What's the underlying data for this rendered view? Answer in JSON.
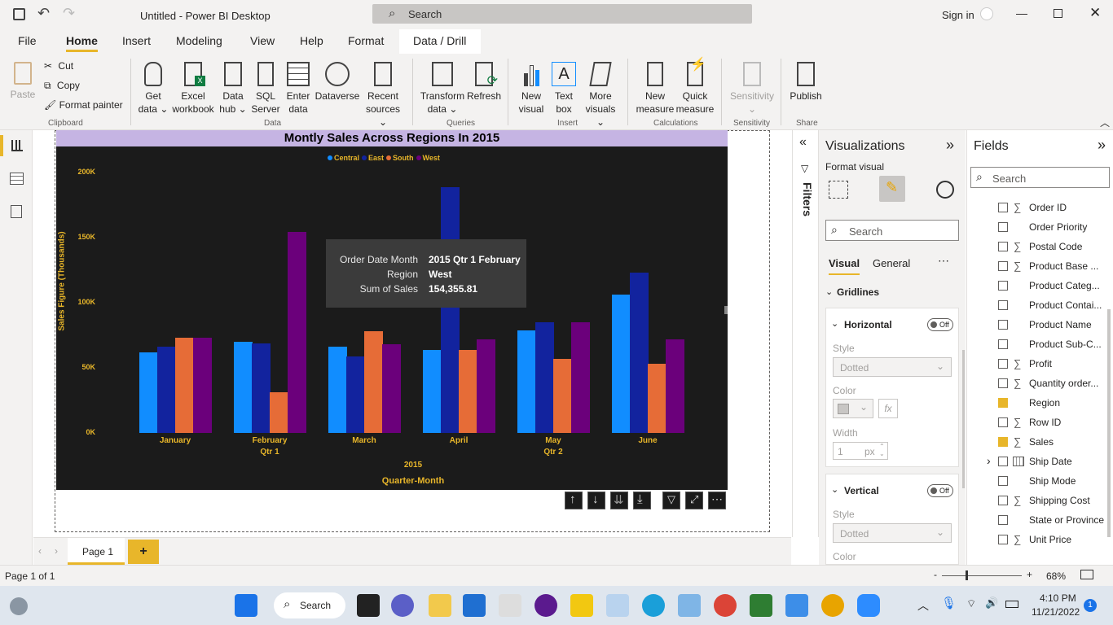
{
  "window": {
    "title": "Untitled - Power BI Desktop",
    "search_placeholder": "Search",
    "sign_in": "Sign in"
  },
  "menu_tabs": [
    "File",
    "Home",
    "Insert",
    "Modeling",
    "View",
    "Help",
    "Format",
    "Data / Drill"
  ],
  "ribbon": {
    "clipboard": {
      "paste": "Paste",
      "cut": "Cut",
      "copy": "Copy",
      "format_painter": "Format painter",
      "group": "Clipboard"
    },
    "data": {
      "get_data": [
        "Get",
        "data"
      ],
      "excel": [
        "Excel",
        "workbook"
      ],
      "data_hub": [
        "Data",
        "hub"
      ],
      "sql": [
        "SQL",
        "Server"
      ],
      "enter": [
        "Enter",
        "data"
      ],
      "dataverse": [
        "Dataverse",
        ""
      ],
      "recent": [
        "Recent",
        "sources"
      ],
      "group": "Data"
    },
    "queries": {
      "transform": [
        "Transform",
        "data"
      ],
      "refresh": [
        "Refresh",
        ""
      ],
      "group": "Queries"
    },
    "insert": {
      "new_visual": [
        "New",
        "visual"
      ],
      "text_box": [
        "Text",
        "box"
      ],
      "more_visuals": [
        "More",
        "visuals"
      ],
      "group": "Insert"
    },
    "calculations": {
      "new_measure": [
        "New",
        "measure"
      ],
      "quick_measure": [
        "Quick",
        "measure"
      ],
      "group": "Calculations"
    },
    "sensitivity": {
      "label": "Sensitivity",
      "group": "Sensitivity"
    },
    "share": {
      "publish": "Publish",
      "group": "Share"
    }
  },
  "chart_data": {
    "type": "bar",
    "title": "Montly Sales Across Regions In 2015",
    "categories": [
      "January",
      "February",
      "March",
      "April",
      "May",
      "June"
    ],
    "category_sublabels": [
      "",
      "Qtr 1",
      "",
      "",
      "Qtr 2",
      ""
    ],
    "year_label": "2015",
    "xlabel": "Quarter-Month",
    "ylabel": "Sales Figure (Thousands)",
    "yticks": [
      "200K",
      "150K",
      "100K",
      "50K",
      "0K"
    ],
    "ylim": [
      0,
      200000
    ],
    "legend_position": "top-center",
    "series": [
      {
        "name": "Central",
        "color": "#118dff",
        "values": [
          62000,
          70000,
          66000,
          64000,
          79000,
          106000
        ]
      },
      {
        "name": "East",
        "color": "#12239e",
        "values": [
          66000,
          69000,
          59000,
          189000,
          85000,
          123000
        ]
      },
      {
        "name": "South",
        "color": "#e66c37",
        "values": [
          73000,
          31000,
          78000,
          64000,
          57000,
          53000
        ]
      },
      {
        "name": "West",
        "color": "#6b007b",
        "values": [
          73000,
          154355.81,
          68000,
          72000,
          85000,
          72000
        ]
      }
    ]
  },
  "tooltip": {
    "rows": [
      {
        "k": "Order Date Month",
        "v": "2015 Qtr 1 February"
      },
      {
        "k": "Region",
        "v": "West"
      },
      {
        "k": "Sum of Sales",
        "v": "154,355.81"
      }
    ]
  },
  "filters_label": "Filters",
  "visualizations": {
    "title": "Visualizations",
    "subtitle": "Format visual",
    "search": "Search",
    "tab_visual": "Visual",
    "tab_general": "General",
    "section": "Gridlines",
    "horizontal": {
      "label": "Horizontal",
      "toggle": "Off",
      "style_label": "Style",
      "style_value": "Dotted",
      "color_label": "Color",
      "width_label": "Width",
      "width_value": "1",
      "width_unit": "px"
    },
    "vertical": {
      "label": "Vertical",
      "toggle": "Off",
      "style_label": "Style",
      "style_value": "Dotted",
      "color_label": "Color"
    }
  },
  "fields": {
    "title": "Fields",
    "search": "Search",
    "items": [
      {
        "name": "Order ID",
        "sigma": true,
        "checked": false
      },
      {
        "name": "Order Priority",
        "sigma": false,
        "checked": false
      },
      {
        "name": "Postal Code",
        "sigma": true,
        "checked": false
      },
      {
        "name": "Product Base ...",
        "sigma": true,
        "checked": false
      },
      {
        "name": "Product Categ...",
        "sigma": false,
        "checked": false
      },
      {
        "name": "Product Contai...",
        "sigma": false,
        "checked": false
      },
      {
        "name": "Product Name",
        "sigma": false,
        "checked": false
      },
      {
        "name": "Product Sub-C...",
        "sigma": false,
        "checked": false
      },
      {
        "name": "Profit",
        "sigma": true,
        "checked": false
      },
      {
        "name": "Quantity order...",
        "sigma": true,
        "checked": false
      },
      {
        "name": "Region",
        "sigma": false,
        "checked": true
      },
      {
        "name": "Row ID",
        "sigma": true,
        "checked": false
      },
      {
        "name": "Sales",
        "sigma": true,
        "checked": true
      },
      {
        "name": "Ship Date",
        "sigma": false,
        "checked": false
      },
      {
        "name": "Ship Mode",
        "sigma": false,
        "checked": false
      },
      {
        "name": "Shipping Cost",
        "sigma": true,
        "checked": false
      },
      {
        "name": "State or Province",
        "sigma": false,
        "checked": false
      },
      {
        "name": "Unit Price",
        "sigma": true,
        "checked": false
      }
    ]
  },
  "pages": {
    "current": "Page 1",
    "add": "+"
  },
  "status": {
    "page_info": "Page 1 of 1",
    "zoom": "68%"
  },
  "taskbar": {
    "search": "Search",
    "time": "4:10 PM",
    "date": "11/21/2022",
    "badge": "1"
  }
}
